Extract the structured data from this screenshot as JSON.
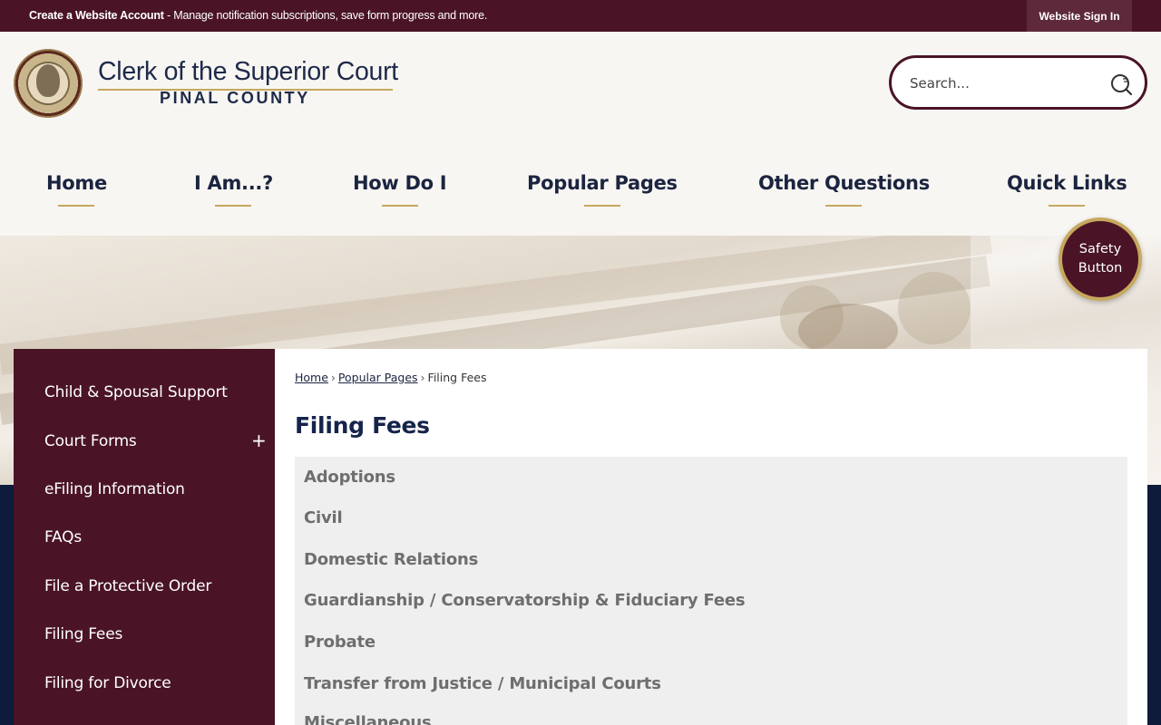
{
  "topbar": {
    "account_link": "Create a Website Account",
    "account_desc": " - Manage notification subscriptions, save form progress and more.",
    "signin": "Website Sign In"
  },
  "header": {
    "title": "Clerk of the Superior Court",
    "subtitle": "PINAL COUNTY"
  },
  "search": {
    "placeholder": "Search..."
  },
  "nav": [
    "Home",
    "I Am...?",
    "How Do I",
    "Popular Pages",
    "Other Questions",
    "Quick Links"
  ],
  "safety_button": "Safety Button",
  "sidebar": {
    "items": [
      "Child & Spousal Support",
      "Court Forms",
      "eFiling Information",
      "FAQs",
      "File a Protective Order",
      "Filing Fees",
      "Filing for Divorce"
    ],
    "expand_symbol": "+"
  },
  "breadcrumb": {
    "home": "Home",
    "parent": "Popular Pages",
    "current": "Filing Fees",
    "separator": "›"
  },
  "page_title": "Filing Fees",
  "accordion": [
    "Adoptions",
    "Civil",
    "Domestic Relations",
    "Guardianship / Conservatorship & Fiduciary Fees",
    "Probate",
    "Transfer from Justice / Municipal Courts",
    "Miscellaneous"
  ],
  "colors": {
    "brand": "#4a1426",
    "accent": "#c6a85e",
    "nav_text": "#1b2440"
  }
}
